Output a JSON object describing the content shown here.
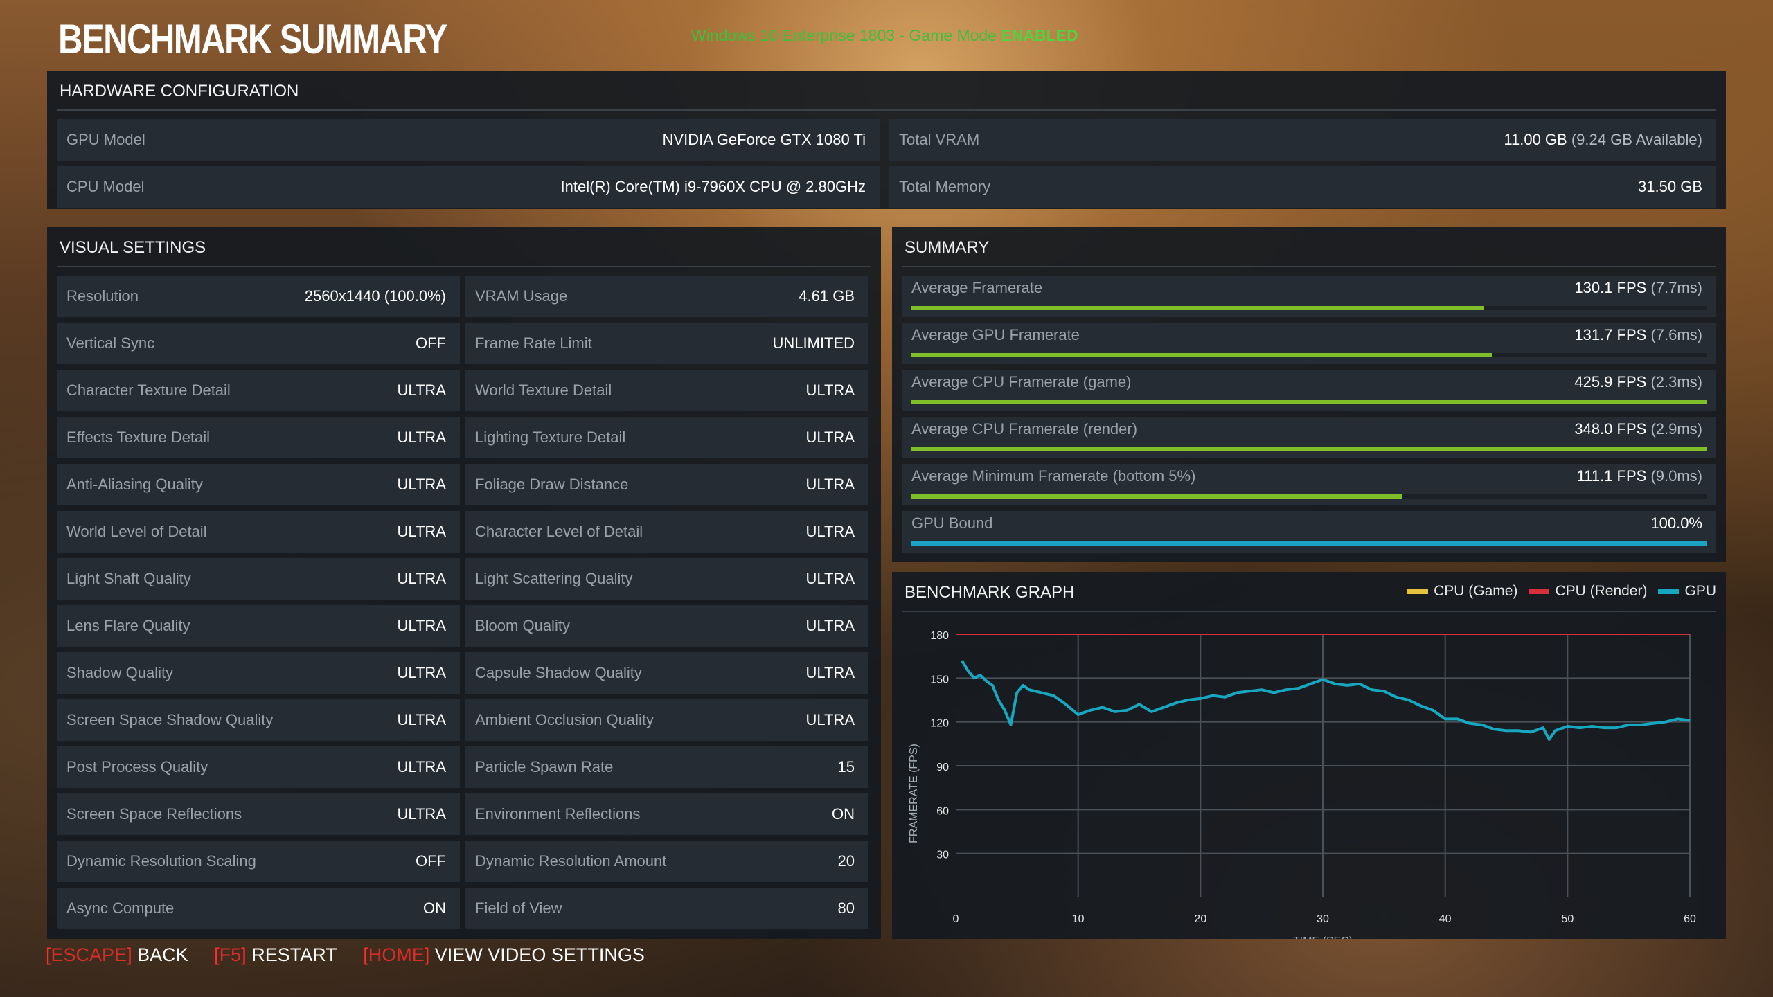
{
  "header": {
    "title": "BENCHMARK SUMMARY",
    "os_text": "Windows 10 Enterprise 1803 - Game Mode ",
    "os_status": "ENABLED"
  },
  "hardware": {
    "heading": "HARDWARE CONFIGURATION",
    "gpu_label": "GPU Model",
    "gpu_value": "NVIDIA GeForce GTX 1080 Ti",
    "cpu_label": "CPU Model",
    "cpu_value": "Intel(R) Core(TM) i9-7960X CPU @ 2.80GHz",
    "vram_label": "Total VRAM",
    "vram_value": "11.00 GB",
    "vram_sub": "(9.24 GB Available)",
    "mem_label": "Total Memory",
    "mem_value": "31.50 GB"
  },
  "visual": {
    "heading": "VISUAL SETTINGS",
    "left": [
      {
        "label": "Resolution",
        "value": "2560x1440 (100.0%)"
      },
      {
        "label": "Vertical Sync",
        "value": "OFF"
      },
      {
        "label": "Character Texture Detail",
        "value": "ULTRA"
      },
      {
        "label": "Effects Texture Detail",
        "value": "ULTRA"
      },
      {
        "label": "Anti-Aliasing Quality",
        "value": "ULTRA"
      },
      {
        "label": "World Level of Detail",
        "value": "ULTRA"
      },
      {
        "label": "Light Shaft Quality",
        "value": "ULTRA"
      },
      {
        "label": "Lens Flare Quality",
        "value": "ULTRA"
      },
      {
        "label": "Shadow Quality",
        "value": "ULTRA"
      },
      {
        "label": "Screen Space Shadow Quality",
        "value": "ULTRA"
      },
      {
        "label": "Post Process Quality",
        "value": "ULTRA"
      },
      {
        "label": "Screen Space Reflections",
        "value": "ULTRA"
      },
      {
        "label": "Dynamic Resolution Scaling",
        "value": "OFF"
      },
      {
        "label": "Async Compute",
        "value": "ON"
      }
    ],
    "right": [
      {
        "label": "VRAM Usage",
        "value": "4.61 GB"
      },
      {
        "label": "Frame Rate Limit",
        "value": "UNLIMITED"
      },
      {
        "label": "World Texture Detail",
        "value": "ULTRA"
      },
      {
        "label": "Lighting Texture Detail",
        "value": "ULTRA"
      },
      {
        "label": "Foliage Draw Distance",
        "value": "ULTRA"
      },
      {
        "label": "Character Level of Detail",
        "value": "ULTRA"
      },
      {
        "label": "Light Scattering Quality",
        "value": "ULTRA"
      },
      {
        "label": "Bloom Quality",
        "value": "ULTRA"
      },
      {
        "label": "Capsule Shadow Quality",
        "value": "ULTRA"
      },
      {
        "label": "Ambient Occlusion Quality",
        "value": "ULTRA"
      },
      {
        "label": "Particle Spawn Rate",
        "value": "15"
      },
      {
        "label": "Environment Reflections",
        "value": "ON"
      },
      {
        "label": "Dynamic Resolution Amount",
        "value": "20"
      },
      {
        "label": "Field of View",
        "value": "80"
      }
    ]
  },
  "summary": {
    "heading": "SUMMARY",
    "rows": [
      {
        "label": "Average Framerate",
        "value": "130.1 FPS",
        "sub": "(7.7ms)",
        "fill": 0.72,
        "color": "#7fbf2a"
      },
      {
        "label": "Average GPU Framerate",
        "value": "131.7 FPS",
        "sub": "(7.6ms)",
        "fill": 0.73,
        "color": "#7fbf2a"
      },
      {
        "label": "Average CPU Framerate (game)",
        "value": "425.9 FPS",
        "sub": "(2.3ms)",
        "fill": 1.0,
        "color": "#7fbf2a"
      },
      {
        "label": "Average CPU Framerate (render)",
        "value": "348.0 FPS",
        "sub": "(2.9ms)",
        "fill": 1.0,
        "color": "#7fbf2a"
      },
      {
        "label": "Average Minimum Framerate (bottom 5%)",
        "value": "111.1 FPS",
        "sub": "(9.0ms)",
        "fill": 0.617,
        "color": "#7fbf2a"
      },
      {
        "label": "GPU Bound",
        "value": "100.0%",
        "sub": "",
        "fill": 1.0,
        "color": "#1aa3c4"
      }
    ]
  },
  "graph": {
    "heading": "BENCHMARK GRAPH",
    "legend": [
      {
        "name": "CPU (Game)",
        "color": "#e8c23a"
      },
      {
        "name": "CPU (Render)",
        "color": "#d8303a"
      },
      {
        "name": "GPU",
        "color": "#18a7c0"
      }
    ]
  },
  "chart_data": {
    "type": "line",
    "xlabel": "TIME (SEC)",
    "ylabel": "FRAMERATE (FPS)",
    "xlim": [
      0,
      60
    ],
    "ylim": [
      0,
      180
    ],
    "xticks": [
      0,
      10,
      20,
      30,
      40,
      50,
      60
    ],
    "yticks": [
      30,
      60,
      90,
      120,
      150,
      180
    ],
    "grid": true,
    "series": [
      {
        "name": "GPU",
        "color": "#18a7c0",
        "x": [
          0.5,
          1,
          1.5,
          2,
          2.5,
          3,
          3.5,
          4,
          4.5,
          5,
          5.5,
          6,
          7,
          8,
          9,
          10,
          11,
          12,
          13,
          14,
          15,
          16,
          17,
          18,
          19,
          20,
          21,
          22,
          23,
          24,
          25,
          26,
          27,
          28,
          29,
          30,
          31,
          32,
          33,
          34,
          35,
          36,
          37,
          38,
          39,
          40,
          41,
          42,
          43,
          44,
          45,
          46,
          47,
          48,
          48.5,
          49,
          50,
          51,
          52,
          53,
          54,
          55,
          56,
          57,
          58,
          59,
          60
        ],
        "y": [
          162,
          155,
          150,
          152,
          148,
          145,
          135,
          128,
          118,
          140,
          145,
          142,
          140,
          138,
          132,
          125,
          128,
          130,
          127,
          128,
          132,
          127,
          130,
          133,
          135,
          136,
          138,
          137,
          140,
          141,
          142,
          140,
          142,
          143,
          146,
          149,
          146,
          145,
          146,
          142,
          141,
          137,
          135,
          131,
          128,
          122,
          122,
          119,
          118,
          115,
          114,
          114,
          113,
          116,
          108,
          114,
          117,
          116,
          117,
          116,
          116,
          118,
          118,
          119,
          120,
          122,
          121
        ]
      },
      {
        "name": "CPU (Render)",
        "color": "#d8303a",
        "x": [
          0,
          60
        ],
        "y": [
          180,
          180
        ]
      }
    ]
  },
  "footer": {
    "escape_key": "ESCAPE",
    "escape_action": "BACK",
    "f5_key": "F5",
    "f5_action": "RESTART",
    "home_key": "HOME",
    "home_action": "VIEW VIDEO SETTINGS"
  }
}
